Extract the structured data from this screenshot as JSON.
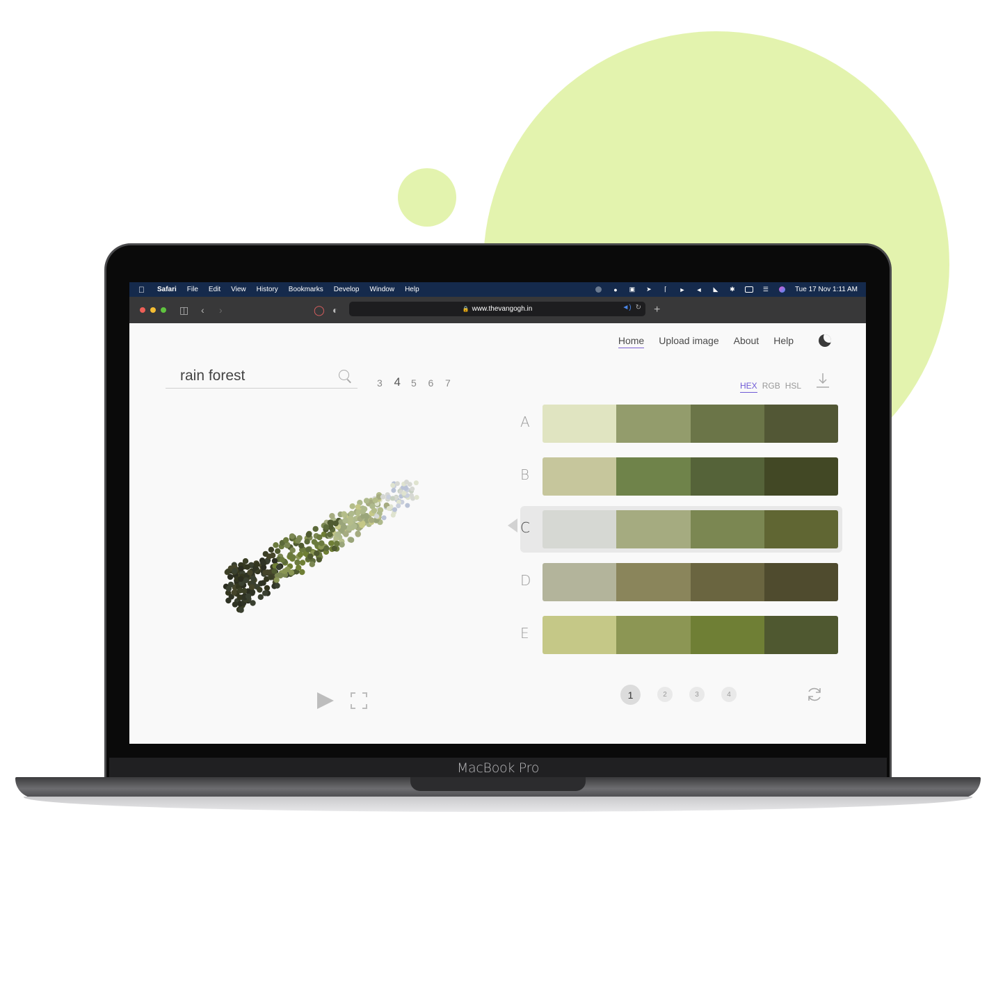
{
  "os_menu": {
    "items": [
      "Safari",
      "File",
      "Edit",
      "View",
      "History",
      "Bookmarks",
      "Develop",
      "Window",
      "Help"
    ],
    "clock": "Tue 17 Nov  1:11 AM"
  },
  "browser": {
    "url": "www.thevangogh.in"
  },
  "nav": {
    "home": "Home",
    "upload": "Upload image",
    "about": "About",
    "help": "Help"
  },
  "search": {
    "value": "rain forest"
  },
  "color_counts": [
    "3",
    "4",
    "5",
    "6",
    "7"
  ],
  "selected_count": "4",
  "formats": {
    "hex": "HEX",
    "rgb": "RGB",
    "hsl": "HSL",
    "active": "HEX"
  },
  "palettes": [
    {
      "label": "A",
      "colors": [
        "#e0e4c1",
        "#939c6c",
        "#6b7548",
        "#525735"
      ]
    },
    {
      "label": "B",
      "colors": [
        "#c6c69c",
        "#6f834a",
        "#556339",
        "#424825"
      ]
    },
    {
      "label": "C",
      "colors": [
        "#d6d8d3",
        "#a5ab80",
        "#7b8752",
        "#606633"
      ],
      "selected": true
    },
    {
      "label": "D",
      "colors": [
        "#b3b49b",
        "#8a855b",
        "#6a6540",
        "#4f4b2e"
      ]
    },
    {
      "label": "E",
      "colors": [
        "#c5c887",
        "#8c9654",
        "#6f7f35",
        "#4f5830"
      ]
    }
  ],
  "pagination": [
    "1",
    "2",
    "3",
    "4"
  ],
  "current_page": "1",
  "laptop_brand": "MacBook Pro",
  "colors": {
    "accent": "#6f5ad6",
    "deco": "#e3f3ae",
    "menubar": "#152a4c"
  }
}
